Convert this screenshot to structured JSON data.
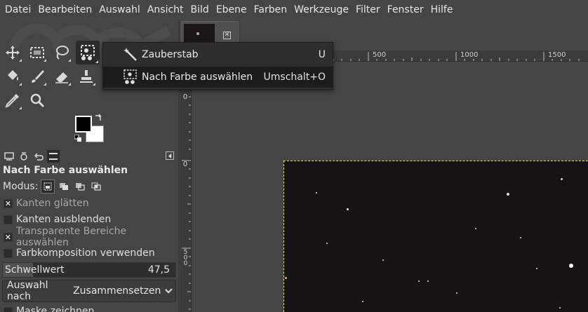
{
  "menubar": {
    "items": [
      "Datei",
      "Bearbeiten",
      "Auswahl",
      "Ansicht",
      "Bild",
      "Ebene",
      "Farben",
      "Werkzeuge",
      "Filter",
      "Fenster",
      "Hilfe"
    ]
  },
  "toolbox": {
    "tools": [
      {
        "name": "move",
        "icon": "move-icon"
      },
      {
        "name": "rect-select",
        "icon": "rect-select-icon"
      },
      {
        "name": "lasso",
        "icon": "lasso-icon"
      },
      {
        "name": "fuzzy-select",
        "icon": "fuzzy-select-icon",
        "active": true
      },
      {
        "name": "bucket-fill",
        "icon": "bucket-fill-icon"
      },
      {
        "name": "paintbrush",
        "icon": "paintbrush-icon"
      },
      {
        "name": "eraser",
        "icon": "eraser-icon"
      },
      {
        "name": "clone",
        "icon": "clone-stamp-icon"
      },
      {
        "name": "color-picker",
        "icon": "color-picker-icon"
      },
      {
        "name": "zoom",
        "icon": "zoom-icon"
      }
    ],
    "foreground_color": "#000000",
    "background_color": "#ffffff"
  },
  "tool_options": {
    "title": "Nach Farbe auswählen",
    "mode_label": "Modus:",
    "options": [
      {
        "label": "Kanten glätten",
        "checked": true,
        "dim": true
      },
      {
        "label": "Kanten ausblenden",
        "checked": false,
        "dim": false
      },
      {
        "label": "Transparente Bereiche auswählen",
        "checked": true,
        "dim": true
      },
      {
        "label": "Farbkomposition verwenden",
        "checked": false,
        "dim": false
      }
    ],
    "threshold_label": "Schwellwert",
    "threshold_value": "47,5",
    "select_by_label": "Auswahl nach",
    "select_by_value": "Zusammensetzen",
    "draw_mask_label": "Maske zeichnen"
  },
  "popup": {
    "items": [
      {
        "label": "Zauberstab",
        "shortcut": "U",
        "icon": "magic-wand-icon",
        "highlighted": false
      },
      {
        "label": "Nach Farbe auswählen",
        "shortcut": "Umschalt+O",
        "icon": "select-by-color-icon",
        "highlighted": true
      }
    ]
  },
  "rulers": {
    "top_labels": [
      "500",
      "1000",
      "1500"
    ],
    "left_labels": [
      "0",
      "0",
      "500"
    ]
  },
  "colors": {
    "selection_outline": "#e7e26a",
    "image_background": "#161314"
  }
}
